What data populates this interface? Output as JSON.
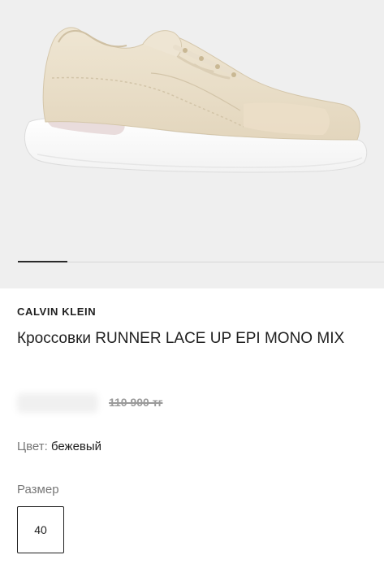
{
  "product": {
    "brand": "CALVIN KLEIN",
    "title": "Кроссовки RUNNER LACE UP EPI MONO MIX",
    "old_price": "110 900 тг",
    "color_label": "Цвет:",
    "color_value": "бежевый",
    "size_label": "Размер",
    "sizes": [
      "40"
    ]
  },
  "gallery": {
    "image_subject": "sneaker-image",
    "current_index": 1
  },
  "colors": {
    "background_gallery": "#efefef",
    "shoe_upper": "#eadfc9",
    "sole": "#ffffff",
    "text_muted": "#777777"
  }
}
